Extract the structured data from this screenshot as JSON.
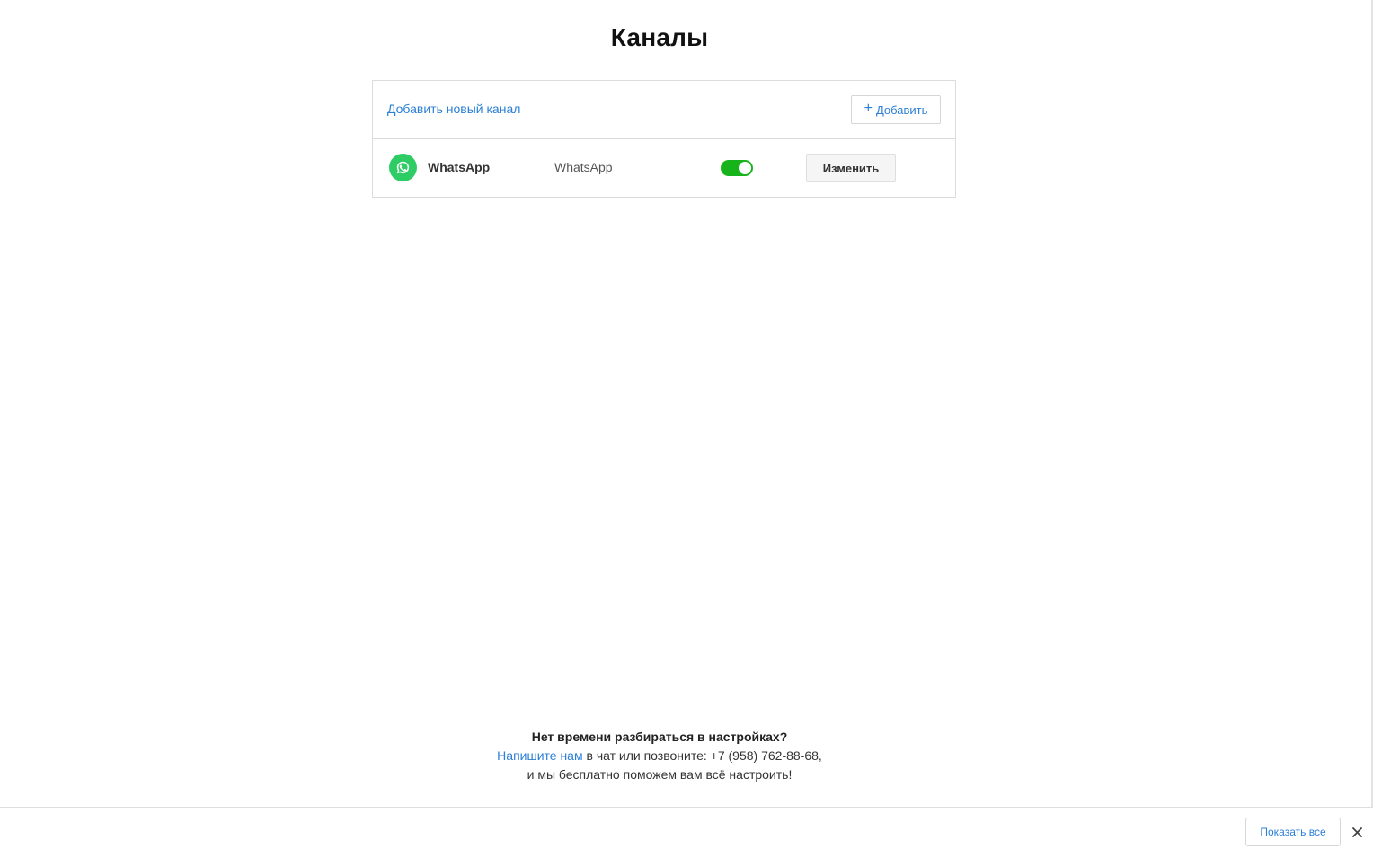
{
  "page": {
    "title": "Каналы"
  },
  "card": {
    "add_link_label": "Добавить новый канал",
    "add_button_icon": "+",
    "add_button_label": "Добавить"
  },
  "channels": [
    {
      "icon": "whatsapp-icon",
      "name": "WhatsApp",
      "type": "WhatsApp",
      "enabled": true,
      "edit_label": "Изменить"
    }
  ],
  "help": {
    "title": "Нет времени разбираться в настройках?",
    "link_label": "Напишите нам",
    "line1_rest": " в чат или позвоните: +7 (958) 762-88-68,",
    "line2": "и мы бесплатно поможем вам всё настроить!"
  },
  "bottom_bar": {
    "show_all_label": "Показать все",
    "close_icon": "close-icon"
  },
  "colors": {
    "accent": "#2a7fd6",
    "toggle_on": "#17b31b",
    "whatsapp": "#2ecc65"
  }
}
